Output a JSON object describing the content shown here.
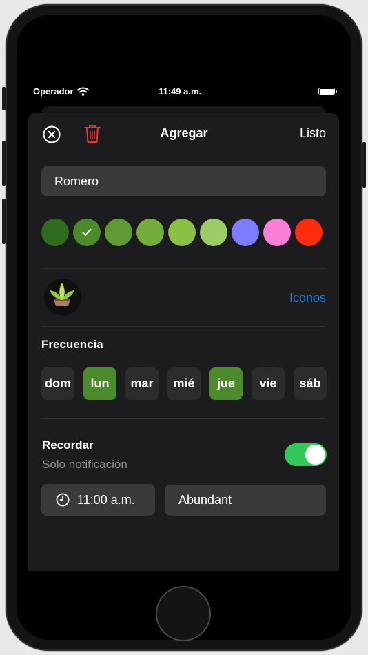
{
  "status_bar": {
    "carrier": "Operador",
    "time": "11:49 a.m."
  },
  "nav": {
    "title": "Agregar",
    "done_label": "Listo",
    "close_icon": "close-circle-icon",
    "trash_icon": "trash-icon"
  },
  "name_field": {
    "value": "Romero"
  },
  "colors": {
    "options": [
      "#2f6b1c",
      "#4c8b2b",
      "#5f9a35",
      "#74ad3c",
      "#8bc143",
      "#9ccc65",
      "#7c7cff",
      "#f87fd5",
      "#ff2d0f"
    ],
    "selected_index": 1
  },
  "icon_section": {
    "link_label": "Iconos",
    "icon": "potted-plant-icon"
  },
  "frequency": {
    "label": "Frecuencia",
    "days": [
      {
        "label": "dom",
        "selected": false
      },
      {
        "label": "lun",
        "selected": true
      },
      {
        "label": "mar",
        "selected": false
      },
      {
        "label": "mié",
        "selected": false
      },
      {
        "label": "jue",
        "selected": true
      },
      {
        "label": "vie",
        "selected": false
      },
      {
        "label": "sáb",
        "selected": false
      }
    ]
  },
  "reminder": {
    "title": "Recordar",
    "subtitle": "Solo notificación",
    "enabled": true,
    "time": "11:00 a.m.",
    "sound": "Abundant"
  },
  "theme": {
    "accent": "#0a84ff",
    "toggle_on": "#34c759",
    "trash_red": "#e5372e"
  }
}
